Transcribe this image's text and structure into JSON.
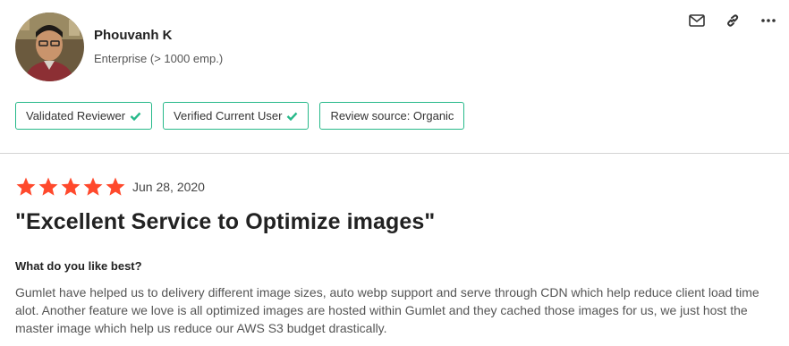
{
  "reviewer": {
    "name": "Phouvanh K",
    "company_size": "Enterprise (> 1000 emp.)"
  },
  "actions": [
    {
      "icon": "mail-icon"
    },
    {
      "icon": "link-icon"
    },
    {
      "icon": "more-icon"
    }
  ],
  "badges": [
    {
      "label": "Validated Reviewer",
      "checked": true
    },
    {
      "label": "Verified Current User",
      "checked": true
    },
    {
      "label": "Review source: Organic",
      "checked": false
    }
  ],
  "review": {
    "rating": 5,
    "max_rating": 5,
    "date": "Jun 28, 2020",
    "title": "\"Excellent Service to Optimize images\"",
    "question": "What do you like best?",
    "answer": "Gumlet have helped us to delivery different image sizes, auto webp support and serve through CDN which help reduce client load time alot. Another feature we love is all optimized images are hosted within Gumlet and they cached those images for us, we just host the master image which help us reduce our AWS S3 budget drastically."
  },
  "colors": {
    "star": "#ff492c",
    "badge_border": "#27b98a",
    "check": "#27b98a",
    "divider": "#d4d4d4"
  }
}
